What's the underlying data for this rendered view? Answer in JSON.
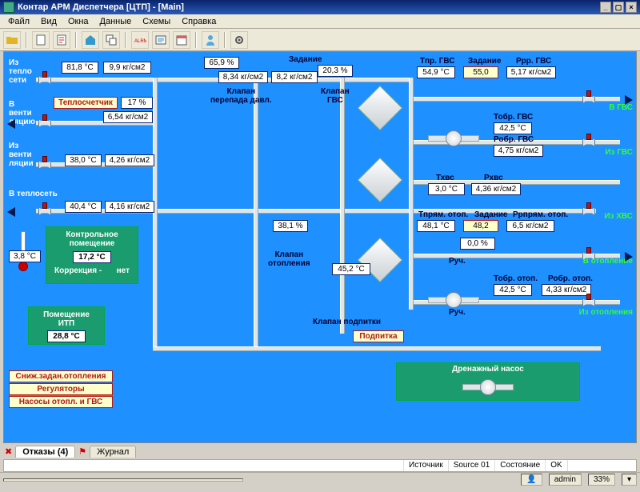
{
  "title": "Контар АРМ Диспетчера [ЦТП] - [Main]",
  "menu": {
    "file": "Файл",
    "view": "Вид",
    "windows": "Окна",
    "data": "Данные",
    "schemes": "Схемы",
    "help": "Справка"
  },
  "labels": {
    "iz_teplo_seti": "Из\nтепло\nсети",
    "v_venti": "В\nвенти\nляцию",
    "iz_venti": "Из\nвенти\nляции",
    "v_teploset": "В теплосеть",
    "teploschetchik": "Теплосчетчик",
    "klapan_perep": "Клапан\nперепада давл.",
    "klapan_gvs": "Клапан\nГВС",
    "klapan_otop": "Клапан\nотопления",
    "klapan_podp": "Клапан подпитки",
    "zadanie": "Задание",
    "tpr_gvs": "Тпр. ГВС",
    "zad2": "Задание",
    "ppr_gvs": "Ррр. ГВС",
    "tobr_gvs": "Тобр. ГВС",
    "pobr_gvs": "Робр. ГВС",
    "txvs": "Тхвс",
    "pxvs": "Рхвс",
    "tpr_ot": "Тпрям. отоп.",
    "zad3": "Задание",
    "ppr_ot": "Ррпрям. отоп.",
    "tobr_ot": "Тобр. отоп.",
    "pobr_ot": "Робр. отоп.",
    "ruch": "Руч.",
    "drain": "Дренажный насос",
    "kontr_room": "Контрольное\nпомещение",
    "korrek": "Коррекция -",
    "net": "нет",
    "room_itp": "Помещение\nИТП",
    "podpitka": "Подпитка",
    "sn_zad": "Сниж.задан.отопления",
    "regulators": "Регуляторы",
    "nasosy": "Насосы отопл. и ГВС",
    "v_gvs": "В ГВС",
    "iz_gvs": "Из ГВС",
    "iz_xvs": "Из ХВС",
    "v_otop": "В отопление",
    "iz_otop": "Из отопления"
  },
  "v": {
    "t1": "81,8  °C",
    "p1": "9,9  кг/см2",
    "kl_perep": "65,9  %",
    "q1": "8,34  кг/см2",
    "q2": "8,2  кг/см2",
    "kl_gvs": "20,3  %",
    "gvs_t": "54,9  °C",
    "gvs_z": "55,0",
    "gvs_p": "5,17 кг/см2",
    "tobr_gvs_v": "42,5  °C",
    "pobr_gvs_v": "4,75 кг/см2",
    "pct17": "17  %",
    "p_vent": "6,54  кг/см2",
    "t_vent": "38,0  °C",
    "p_vent2": "4,26  кг/см2",
    "t_ts": "40,4  °C",
    "p_ts": "4,16  кг/см2",
    "kl_otop": "38,1  %",
    "t_mid": "45,2  °C",
    "txvs_v": "3,0  °C",
    "pxvs_v": "4,36  кг/см2",
    "tpr_ot_v": "48,1  °C",
    "zad_ot": "48,2",
    "ppr_ot_v": "6,5  кг/см2",
    "zero_pct": "0,0  %",
    "tobr_ot_v": "42,5  °C",
    "pobr_ot_v": "4,33  кг/см2",
    "thermo_t": "3,8  °C",
    "kontr_t": "17,2  °C",
    "itp_t": "28,8  °C"
  },
  "tabs": {
    "otkazy": "Отказы (4)",
    "journal": "Журнал"
  },
  "logbar": {
    "src_h": "Источник",
    "src_v": "Source 01",
    "st_h": "Состояние",
    "st_v": "OK"
  },
  "status": {
    "user_icon": "👤",
    "admin": "admin",
    "pct": "33%"
  }
}
